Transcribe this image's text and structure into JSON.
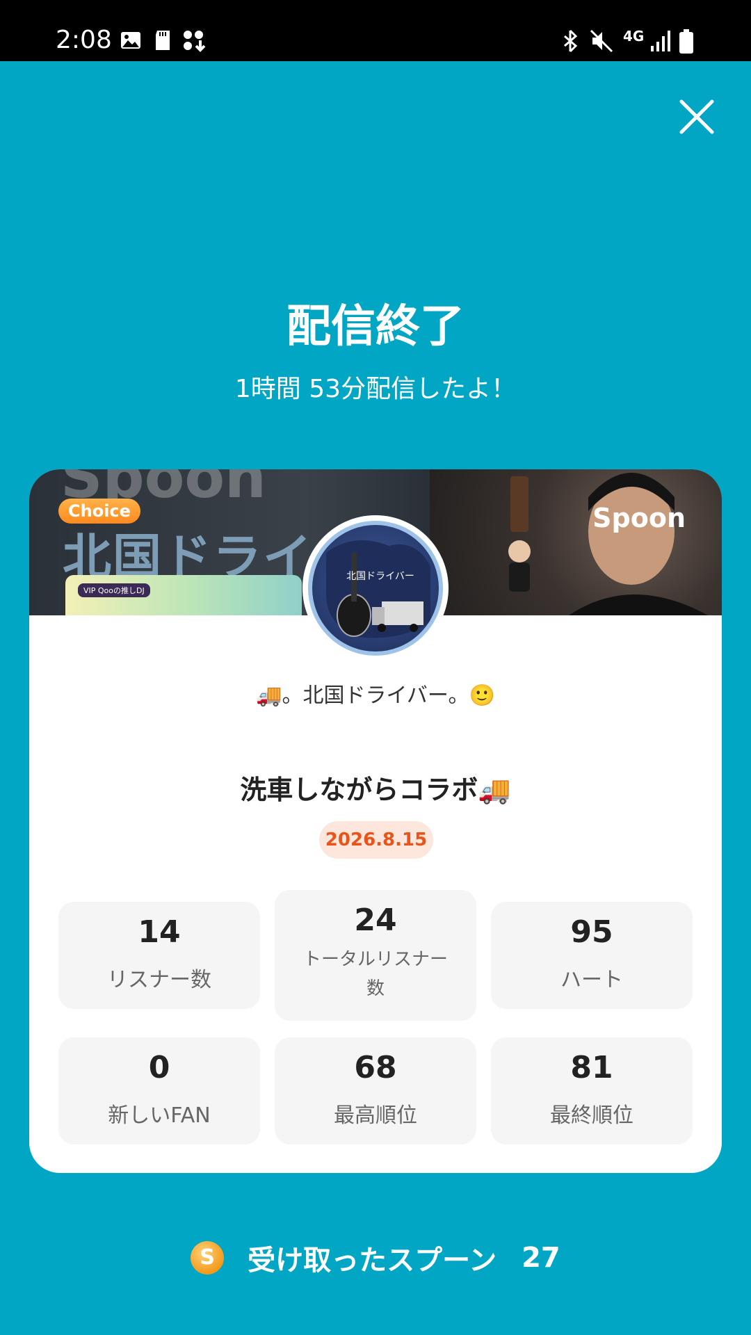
{
  "status_bar": {
    "time": "2:08",
    "left_icons": [
      "image-icon",
      "sd-card-icon",
      "download-icon"
    ],
    "right_icons": [
      "bluetooth-icon",
      "mute-icon",
      "4g-icon",
      "signal-icon",
      "battery-icon"
    ],
    "network": "4G"
  },
  "header": {
    "title": "配信終了",
    "subtitle": "1時間 53分配信したよ！"
  },
  "banner": {
    "ghost_text": "Spoon",
    "badge": "Choice",
    "headline": "北国ドライバ",
    "vip_tag": "VIP Qooの推しDJ",
    "brand": "Spoon"
  },
  "avatar": {
    "text": "北国ドライバー"
  },
  "card": {
    "dj_name": "🚚。北国ドライバー。🙂",
    "show_title": "洗車しながらコラボ🚚",
    "date": "2026.8.15"
  },
  "stats": [
    {
      "value": "14",
      "label": "リスナー数"
    },
    {
      "value": "24",
      "label": "トータルリスナー数"
    },
    {
      "value": "95",
      "label": "ハート"
    },
    {
      "value": "0",
      "label": "新しいFAN"
    },
    {
      "value": "68",
      "label": "最高順位"
    },
    {
      "value": "81",
      "label": "最終順位"
    }
  ],
  "footer": {
    "coin": "S",
    "spoons_label": "受け取ったスプーン",
    "spoons_count": "27"
  },
  "colors": {
    "background": "#00a6c4",
    "date_text": "#e8541a",
    "date_bg": "#fde6dc",
    "choice_badge": "#ff8a1e"
  }
}
